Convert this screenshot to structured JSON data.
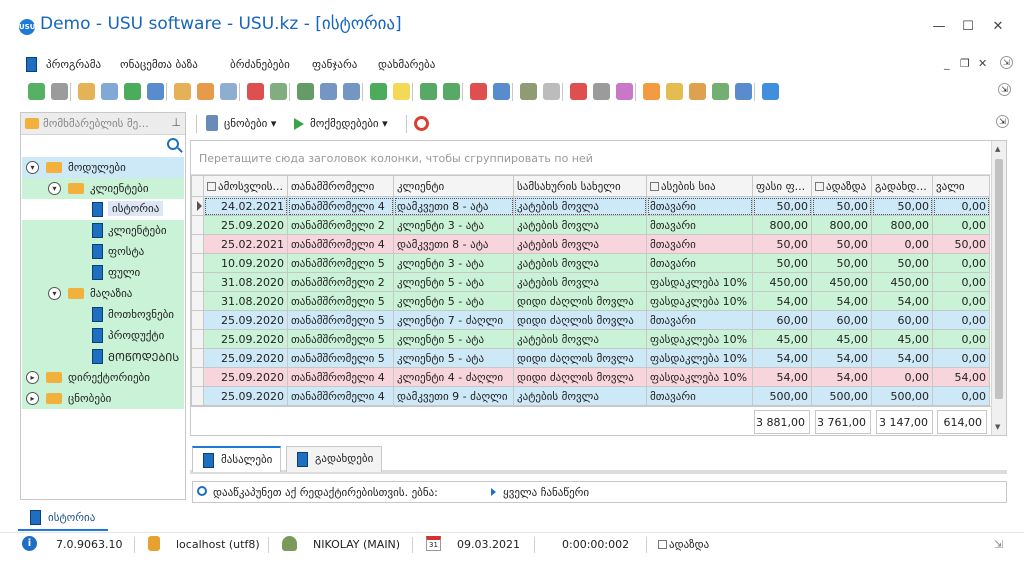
{
  "window": {
    "logo_text": "USU",
    "title": "Demo - USU software - USU.kz - [ისტორია]",
    "minimize": "—",
    "maximize": "☐",
    "close": "✕"
  },
  "menu": {
    "items": [
      "პროგრამა",
      "ონაცემთა ბაზა",
      "ბრძანებები",
      "ფანჯარა",
      "დახმარება"
    ],
    "mdi": {
      "minimize": "_",
      "restore": "❐",
      "close": "✕"
    }
  },
  "toolbar": {
    "icons": [
      {
        "name": "new-record-icon",
        "color": "#3aa34a"
      },
      {
        "name": "copy-icon",
        "color": "#8a8a8a"
      },
      {
        "name": "edit-icon",
        "color": "#e0a63a"
      },
      {
        "name": "delete-icon",
        "color": "#6a9ad0"
      },
      {
        "name": "refresh-icon",
        "color": "#2e9e3e"
      },
      {
        "name": "search-icon",
        "color": "#3b78c4"
      },
      {
        "name": "filter-icon",
        "color": "#e2a23a"
      },
      {
        "name": "filter-clear-icon",
        "color": "#e28a2a"
      },
      {
        "name": "filter-settings-icon",
        "color": "#7aa0c8"
      },
      {
        "name": "flag-icon",
        "color": "#d83030"
      },
      {
        "name": "image-icon",
        "color": "#6aa06a"
      },
      {
        "name": "columns-icon",
        "color": "#4a8a4a"
      },
      {
        "name": "expand-icon",
        "color": "#5a84b8"
      },
      {
        "name": "collapse-icon",
        "color": "#5a84b8"
      },
      {
        "name": "add-row-icon",
        "color": "#2e9e3e"
      },
      {
        "name": "note-icon",
        "color": "#f2d23a"
      },
      {
        "name": "export-icon",
        "color": "#3a9a4a"
      },
      {
        "name": "export-dropdown-icon",
        "color": "#3a9a4a"
      },
      {
        "name": "new-window-icon",
        "color": "#d83030"
      },
      {
        "name": "close-window-icon",
        "color": "#3b78c4"
      },
      {
        "name": "exit-icon",
        "color": "#7a8a5a"
      },
      {
        "name": "back-circle-icon",
        "color": "#b0b0b0"
      },
      {
        "name": "calendar-icon",
        "color": "#d83030"
      },
      {
        "name": "settings-icon",
        "color": "#8a8a8a"
      },
      {
        "name": "palette-icon",
        "color": "#c060c0"
      },
      {
        "name": "rss-icon",
        "color": "#f08a20"
      },
      {
        "name": "lock-icon",
        "color": "#e0b030"
      },
      {
        "name": "user-icon",
        "color": "#d89030"
      },
      {
        "name": "users-icon",
        "color": "#5aa05a"
      },
      {
        "name": "pin-icon",
        "color": "#3b78c4"
      },
      {
        "name": "info-icon",
        "color": "#1e7ad6"
      }
    ]
  },
  "sidebar": {
    "header": "მომხმარებლის მე...",
    "pin": "⊥",
    "tree": [
      {
        "label": "მოდულები",
        "level": 0,
        "type": "folder",
        "expanded": true
      },
      {
        "label": "კლიენტები",
        "level": 1,
        "type": "folder",
        "expanded": true
      },
      {
        "label": "ისტორია",
        "level": 2,
        "type": "doc",
        "selected": true
      },
      {
        "label": "კლიენტები",
        "level": 2,
        "type": "doc"
      },
      {
        "label": "ფოსტა",
        "level": 2,
        "type": "doc"
      },
      {
        "label": "ფული",
        "level": 2,
        "type": "doc"
      },
      {
        "label": "მაღაზია",
        "level": 1,
        "type": "folder",
        "expanded": true
      },
      {
        "label": "მოთხოვნები",
        "level": 2,
        "type": "doc"
      },
      {
        "label": "პროდუქტი",
        "level": 2,
        "type": "doc"
      },
      {
        "label": "ᲛᲝᲬᲝᲓᲔᲑᲘᲡ",
        "level": 2,
        "type": "doc"
      },
      {
        "label": "დირექტორიები",
        "level": 0,
        "type": "folder",
        "expanded": false
      },
      {
        "label": "ცნობები",
        "level": 0,
        "type": "folder",
        "expanded": false
      }
    ]
  },
  "subtoolbar": {
    "reports_label": "ცნობები",
    "actions_label": "მოქმედებები"
  },
  "grid": {
    "group_hint": "Перетащите сюда заголовок колонки, чтобы сгруппировать по ней",
    "columns": [
      "ამოსვლის...",
      "თანამშრომელი",
      "კლიენტი",
      "სამსახურის სახელი",
      "ასების სია",
      "ფასი ფ...",
      "ადაზდა",
      "გადახდ...",
      "ვალი"
    ],
    "rows": [
      {
        "tone": "blue",
        "focused": true,
        "cells": [
          "24.02.2021",
          "თანამშრომელი 4",
          "დამკვეთი 8 - ატა",
          "კატების მოვლა",
          "მთავარი",
          "50,00",
          "50,00",
          "50,00",
          "0,00"
        ]
      },
      {
        "tone": "green",
        "cells": [
          "25.09.2020",
          "თანამშრომელი 2",
          "კლიენტი 3 - ატა",
          "კატების მოვლა",
          "მთავარი",
          "800,00",
          "800,00",
          "800,00",
          "0,00"
        ]
      },
      {
        "tone": "pink",
        "cells": [
          "25.02.2021",
          "თანამშრომელი 4",
          "დამკვეთი 8 - ატა",
          "კატების მოვლა",
          "მთავარი",
          "50,00",
          "50,00",
          "0,00",
          "50,00"
        ]
      },
      {
        "tone": "green",
        "cells": [
          "10.09.2020",
          "თანამშრომელი 5",
          "კლიენტი 3 - ატა",
          "კატების მოვლა",
          "მთავარი",
          "50,00",
          "50,00",
          "50,00",
          "0,00"
        ]
      },
      {
        "tone": "green",
        "cells": [
          "31.08.2020",
          "თანამშრომელი 2",
          "კლიენტი 5 - ატა",
          "კატების მოვლა",
          "ფასდაკლება 10%",
          "450,00",
          "450,00",
          "450,00",
          "0,00"
        ]
      },
      {
        "tone": "green",
        "cells": [
          "31.08.2020",
          "თანამშრომელი 5",
          "კლიენტი 5 - ატა",
          "დიდი ძაღლის მოვლა",
          "ფასდაკლება 10%",
          "54,00",
          "54,00",
          "54,00",
          "0,00"
        ]
      },
      {
        "tone": "blue",
        "cells": [
          "25.09.2020",
          "თანამშრომელი 5",
          "კლიენტი 7 - ძაღლი",
          "დიდი ძაღლის მოვლა",
          "მთავარი",
          "60,00",
          "60,00",
          "60,00",
          "0,00"
        ]
      },
      {
        "tone": "green",
        "cells": [
          "25.09.2020",
          "თანამშრომელი 5",
          "კლიენტი 5 - ატა",
          "კატების მოვლა",
          "ფასდაკლება 10%",
          "45,00",
          "45,00",
          "45,00",
          "0,00"
        ]
      },
      {
        "tone": "blue",
        "cells": [
          "25.09.2020",
          "თანამშრომელი 5",
          "კლიენტი 5 - ატა",
          "დიდი ძაღლის მოვლა",
          "ფასდაკლება 10%",
          "54,00",
          "54,00",
          "54,00",
          "0,00"
        ]
      },
      {
        "tone": "pink",
        "cells": [
          "25.09.2020",
          "თანამშრომელი 4",
          "კლიენტი 4 - ძაღლი",
          "დიდი ძაღლის მოვლა",
          "ფასდაკლება 10%",
          "54,00",
          "54,00",
          "0,00",
          "54,00"
        ]
      },
      {
        "tone": "blue",
        "cells": [
          "25.09.2020",
          "თანამშრომელი 4",
          "დამკვეთი 9 - ძაღლი",
          "კატების მოვლა",
          "მთავარი",
          "500,00",
          "500,00",
          "500,00",
          "0,00"
        ]
      }
    ],
    "totals": [
      "3 881,00",
      "3 761,00",
      "3 147,00",
      "614,00"
    ]
  },
  "tabs": [
    {
      "label": "მასალები",
      "active": true
    },
    {
      "label": "გადახდები",
      "active": false
    }
  ],
  "filter": {
    "text": "დააწკაპუნეთ აქ რედაქტირებისთვის. ებნა:",
    "all_label": "ყველა ჩანაწერი"
  },
  "bottom_tab": {
    "label": "ისტორია"
  },
  "status": {
    "version": "7.0.9063.10",
    "server": "localhost (utf8)",
    "user": "NIKOLAY (MAIN)",
    "date": "09.03.2021",
    "timer": "0:00:00:002",
    "mode": "ადაზდა"
  }
}
